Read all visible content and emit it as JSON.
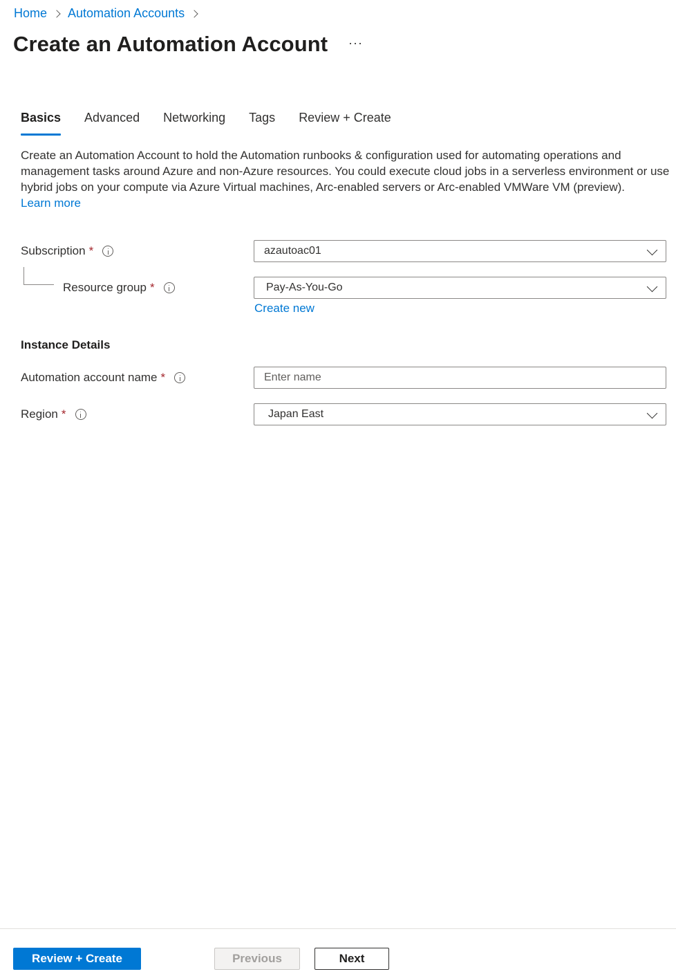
{
  "breadcrumb": [
    {
      "label": "Home"
    },
    {
      "label": "Automation Accounts"
    }
  ],
  "header": {
    "title": "Create an Automation Account",
    "more_label": "···"
  },
  "tabs": [
    {
      "label": "Basics",
      "active": true
    },
    {
      "label": "Advanced",
      "active": false
    },
    {
      "label": "Networking",
      "active": false
    },
    {
      "label": "Tags",
      "active": false
    },
    {
      "label": "Review + Create",
      "active": false
    }
  ],
  "description": {
    "text": "Create an Automation Account to hold the Automation runbooks & configuration used for automating operations and management tasks around Azure and non-Azure resources. You could execute cloud jobs in a serverless environment or use hybrid jobs on your compute via Azure Virtual machines, Arc-enabled servers or Arc-enabled VMWare VM (preview).",
    "learn_more": "Learn more"
  },
  "project": {
    "subscription": {
      "label": "Subscription",
      "required": "*",
      "value": "azautoac01",
      "icon": "info-icon",
      "control_icon": "chevron-down-icon"
    },
    "resource_group": {
      "label": "Resource group",
      "required": "*",
      "value": "Pay-As-You-Go",
      "icon": "info-icon",
      "control_icon": "chevron-down-icon",
      "create_new": "Create new"
    }
  },
  "instance": {
    "section_title": "Instance Details",
    "account_name": {
      "label": "Automation account name",
      "required": "*",
      "value": "",
      "placeholder": "Enter name",
      "icon": "info-icon"
    },
    "region": {
      "label": "Region",
      "required": "*",
      "value": "Japan East",
      "icon": "info-icon",
      "control_icon": "chevron-down-icon"
    }
  },
  "footer": {
    "review_create": "Review + Create",
    "previous": "Previous",
    "next": "Next"
  },
  "colors": {
    "accent": "#0078d4",
    "required": "#a4262c",
    "text": "#323130",
    "disabled_bg": "#f3f2f1"
  }
}
